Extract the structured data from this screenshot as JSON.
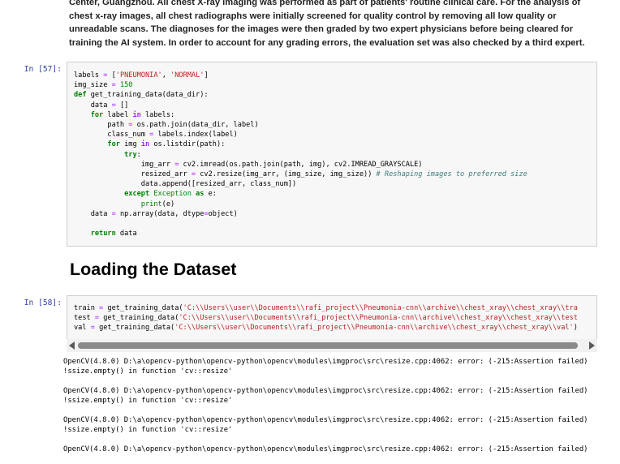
{
  "markdown": {
    "paragraph": "Center, Guangzhou. All chest X-ray imaging was performed as part of patients' routine clinical care. For the analysis of chest x-ray images, all chest radiographs were initially screened for quality control by removing all low quality or unreadable scans. The diagnoses for the images were then graded by two expert physicians before being cleared for training the AI system. In order to account for any grading errors, the evaluation set was also checked by a third expert."
  },
  "cell57": {
    "prompt": "In [57]:",
    "lines": [
      "labels = ['PNEUMONIA', 'NORMAL']",
      "img_size = 150",
      "def get_training_data(data_dir):",
      "    data = []",
      "    for label in labels:",
      "        path = os.path.join(data_dir, label)",
      "        class_num = labels.index(label)",
      "        for img in os.listdir(path):",
      "            try:",
      "                img_arr = cv2.imread(os.path.join(path, img), cv2.IMREAD_GRAYSCALE)",
      "                resized_arr = cv2.resize(img_arr, (img_size, img_size)) # Reshaping images to preferred size",
      "                data.append([resized_arr, class_num])",
      "            except Exception as e:",
      "                print(e)",
      "    data = np.array(data, dtype=object)",
      "",
      "    return data"
    ]
  },
  "heading": "Loading the Dataset",
  "cell58": {
    "prompt": "In [58]:",
    "lines": [
      "train = get_training_data('C:\\\\Users\\\\user\\\\Documents\\\\rafi_project\\\\Pneumonia-cnn\\\\archive\\\\chest_xray\\\\chest_xray\\\\tra",
      "test = get_training_data('C:\\\\Users\\\\user\\\\Documents\\\\rafi_project\\\\Pneumonia-cnn\\\\archive\\\\chest_xray\\\\chest_xray\\\\test",
      "val = get_training_data('C:\\\\Users\\\\user\\\\Documents\\\\rafi_project\\\\Pneumonia-cnn\\\\archive\\\\chest_xray\\\\chest_xray\\\\val')"
    ]
  },
  "output": {
    "errors": [
      {
        "line1": "OpenCV(4.8.0) D:\\a\\opencv-python\\opencv-python\\opencv\\modules\\imgproc\\src\\resize.cpp:4062: error: (-215:Assertion failed)",
        "line2": "!ssize.empty() in function 'cv::resize'"
      },
      {
        "line1": "OpenCV(4.8.0) D:\\a\\opencv-python\\opencv-python\\opencv\\modules\\imgproc\\src\\resize.cpp:4062: error: (-215:Assertion failed)",
        "line2": "!ssize.empty() in function 'cv::resize'"
      },
      {
        "line1": "OpenCV(4.8.0) D:\\a\\opencv-python\\opencv-python\\opencv\\modules\\imgproc\\src\\resize.cpp:4062: error: (-215:Assertion failed)",
        "line2": "!ssize.empty() in function 'cv::resize'"
      },
      {
        "line1": "OpenCV(4.8.0) D:\\a\\opencv-python\\opencv-python\\opencv\\modules\\imgproc\\src\\resize.cpp:4062: error: (-215:Assertion failed)",
        "line2": ""
      }
    ]
  },
  "colors": {
    "prompt": "#303f9f",
    "keyword": "#008000",
    "string": "#ba2121",
    "comment": "#3d7b7b",
    "cell_bg": "#f7f7f7"
  }
}
